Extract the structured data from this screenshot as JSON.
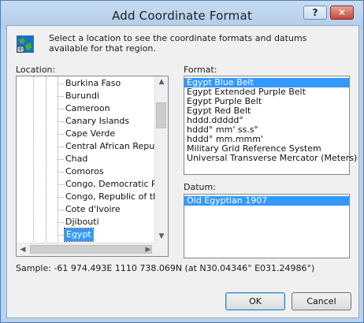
{
  "window": {
    "title": "Add Coordinate Format",
    "help_label": "?",
    "close_label": "✕"
  },
  "intro_text": "Select a location to see the coordinate formats and datums available for that region.",
  "location": {
    "label": "Location:",
    "items": [
      "Burkina Faso",
      "Burundi",
      "Cameroon",
      "Canary Islands",
      "Cape Verde",
      "Central African Republic",
      "Chad",
      "Comoros",
      "Congo, Democratic Rep",
      "Congo, Republic of the",
      "Cote d'Ivoire",
      "Djibouti",
      "Egypt"
    ],
    "selected": "Egypt"
  },
  "format": {
    "label": "Format:",
    "items": [
      "Egypt Blue Belt",
      "Egypt Extended Purple Belt",
      "Egypt Purple Belt",
      "Egypt Red Belt",
      "hddd.ddddd°",
      "hddd° mm' ss.s\"",
      "hddd° mm.mmm'",
      "Military Grid Reference System",
      "Universal Transverse Mercator (Meters)"
    ],
    "selected": "Egypt Blue Belt"
  },
  "datum": {
    "label": "Datum:",
    "items": [
      "Old Egyptian 1907"
    ],
    "selected": "Old Egyptian 1907"
  },
  "sample_text": "Sample: -61 974.493E   1110 738.069N (at N30.04346° E031.24986°)",
  "buttons": {
    "ok": "OK",
    "cancel": "Cancel"
  },
  "colors": {
    "selection": "#3399ff",
    "title_bar": "#b9d1ea",
    "close_button": "#c7463a"
  }
}
